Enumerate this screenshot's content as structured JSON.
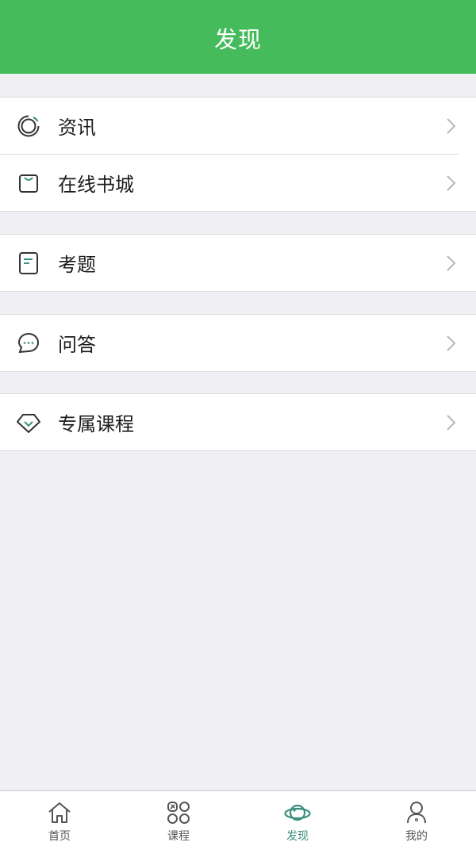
{
  "header": {
    "title": "发现"
  },
  "menu": {
    "group1": [
      {
        "label": "资讯",
        "icon": "news-ring-icon"
      },
      {
        "label": "在线书城",
        "icon": "shopping-bag-icon"
      }
    ],
    "group2": [
      {
        "label": "考题",
        "icon": "exam-paper-icon"
      }
    ],
    "group3": [
      {
        "label": "问答",
        "icon": "chat-bubble-icon"
      }
    ],
    "group4": [
      {
        "label": "专属课程",
        "icon": "diamond-icon"
      }
    ]
  },
  "tabbar": {
    "tabs": [
      {
        "label": "首页",
        "icon": "home-icon"
      },
      {
        "label": "课程",
        "icon": "course-grid-icon"
      },
      {
        "label": "发现",
        "icon": "planet-icon",
        "active": true
      },
      {
        "label": "我的",
        "icon": "user-icon"
      }
    ]
  },
  "colors": {
    "header_green": "#45bb5b",
    "accent_teal": "#3a8f7d",
    "background": "#efeff4"
  }
}
